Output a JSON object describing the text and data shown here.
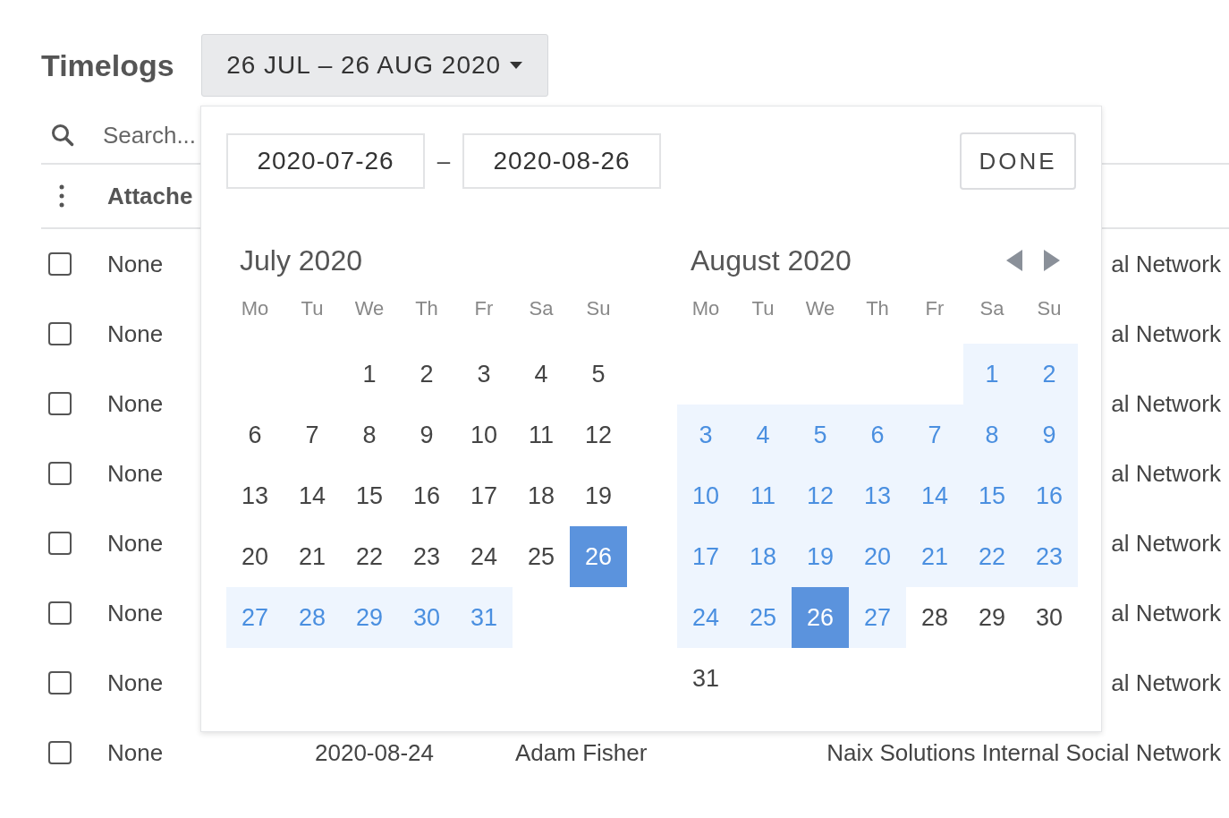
{
  "page": {
    "title": "Timelogs",
    "range_button": "26 JUL – 26 AUG 2020"
  },
  "search": {
    "placeholder": "Search..."
  },
  "table": {
    "columns": [
      {
        "label": "Attache"
      }
    ],
    "rows": [
      {
        "checked": false,
        "attached": "None",
        "project": "al Network"
      },
      {
        "checked": false,
        "attached": "None",
        "project": "al Network"
      },
      {
        "checked": false,
        "attached": "None",
        "project": "al Network"
      },
      {
        "checked": false,
        "attached": "None",
        "project": "al Network"
      },
      {
        "checked": false,
        "attached": "None",
        "project": "al Network"
      },
      {
        "checked": false,
        "attached": "None",
        "project": "al Network"
      },
      {
        "checked": false,
        "attached": "None",
        "project": "al Network"
      },
      {
        "checked": false,
        "attached": "None",
        "date": "2020-08-24",
        "user": "Adam Fisher",
        "project": "Naix Solutions Internal Social Network"
      }
    ]
  },
  "picker": {
    "start": "2020-07-26",
    "separator": "–",
    "end": "2020-08-26",
    "done": "DONE",
    "months": [
      {
        "title": "July 2020",
        "nav": false,
        "weekdays": [
          "Mo",
          "Tu",
          "We",
          "Th",
          "Fr",
          "Sa",
          "Su"
        ],
        "weeks": [
          [
            {
              "label": "1",
              "in_range": false,
              "selected": false
            },
            {
              "label": "2",
              "in_range": false,
              "selected": false
            },
            {
              "label": "3",
              "in_range": false,
              "selected": false
            },
            {
              "label": "4",
              "in_range": false,
              "selected": false
            },
            {
              "label": "5",
              "in_range": false,
              "selected": false
            }
          ],
          [
            {
              "label": "6",
              "in_range": false,
              "selected": false
            },
            {
              "label": "7",
              "in_range": false,
              "selected": false
            },
            {
              "label": "8",
              "in_range": false,
              "selected": false
            },
            {
              "label": "9",
              "in_range": false,
              "selected": false
            },
            {
              "label": "10",
              "in_range": false,
              "selected": false
            },
            {
              "label": "11",
              "in_range": false,
              "selected": false
            },
            {
              "label": "12",
              "in_range": false,
              "selected": false
            }
          ],
          [
            {
              "label": "13",
              "in_range": false,
              "selected": false
            },
            {
              "label": "14",
              "in_range": false,
              "selected": false
            },
            {
              "label": "15",
              "in_range": false,
              "selected": false
            },
            {
              "label": "16",
              "in_range": false,
              "selected": false
            },
            {
              "label": "17",
              "in_range": false,
              "selected": false
            },
            {
              "label": "18",
              "in_range": false,
              "selected": false
            },
            {
              "label": "19",
              "in_range": false,
              "selected": false
            }
          ],
          [
            {
              "label": "20",
              "in_range": false,
              "selected": false
            },
            {
              "label": "21",
              "in_range": false,
              "selected": false
            },
            {
              "label": "22",
              "in_range": false,
              "selected": false
            },
            {
              "label": "23",
              "in_range": false,
              "selected": false
            },
            {
              "label": "24",
              "in_range": false,
              "selected": false
            },
            {
              "label": "25",
              "in_range": false,
              "selected": false
            },
            {
              "label": "26",
              "selected": true
            }
          ],
          [
            {
              "label": "27",
              "in_range": true,
              "selected": false
            },
            {
              "label": "28",
              "in_range": true,
              "selected": false
            },
            {
              "label": "29",
              "in_range": true,
              "selected": false
            },
            {
              "label": "30",
              "in_range": true,
              "selected": false
            },
            {
              "label": "31",
              "in_range": true,
              "selected": false
            }
          ]
        ]
      },
      {
        "title": "August 2020",
        "nav": true,
        "weekdays": [
          "Mo",
          "Tu",
          "We",
          "Th",
          "Fr",
          "Sa",
          "Su"
        ],
        "weeks": [
          [
            {
              "label": "1",
              "in_range": true,
              "selected": false
            },
            {
              "label": "2",
              "in_range": true,
              "selected": false
            }
          ],
          [
            {
              "label": "3",
              "in_range": true,
              "selected": false
            },
            {
              "label": "4",
              "in_range": true,
              "selected": false
            },
            {
              "label": "5",
              "in_range": true,
              "selected": false
            },
            {
              "label": "6",
              "in_range": true,
              "selected": false
            },
            {
              "label": "7",
              "in_range": true,
              "selected": false
            },
            {
              "label": "8",
              "in_range": true,
              "selected": false
            },
            {
              "label": "9",
              "in_range": true,
              "selected": false
            }
          ],
          [
            {
              "label": "10",
              "in_range": true,
              "selected": false
            },
            {
              "label": "11",
              "in_range": true,
              "selected": false
            },
            {
              "label": "12",
              "in_range": true,
              "selected": false
            },
            {
              "label": "13",
              "in_range": true,
              "selected": false
            },
            {
              "label": "14",
              "in_range": true,
              "selected": false
            },
            {
              "label": "15",
              "in_range": true,
              "selected": false
            },
            {
              "label": "16",
              "in_range": true,
              "selected": false
            }
          ],
          [
            {
              "label": "17",
              "in_range": true,
              "selected": false
            },
            {
              "label": "18",
              "in_range": true,
              "selected": false
            },
            {
              "label": "19",
              "in_range": true,
              "selected": false
            },
            {
              "label": "20",
              "in_range": true,
              "selected": false
            },
            {
              "label": "21",
              "in_range": true,
              "selected": false
            },
            {
              "label": "22",
              "in_range": true,
              "selected": false
            },
            {
              "label": "23",
              "in_range": true,
              "selected": false
            }
          ],
          [
            {
              "label": "24",
              "in_range": true,
              "selected": false
            },
            {
              "label": "25",
              "in_range": true,
              "selected": false
            },
            {
              "label": "26",
              "selected": true
            },
            {
              "label": "27",
              "in_range": true,
              "selected": false
            },
            {
              "label": "28",
              "in_range": false,
              "selected": false
            },
            {
              "label": "29",
              "in_range": false,
              "selected": false
            },
            {
              "label": "30",
              "in_range": false,
              "selected": false
            }
          ],
          [
            {
              "label": "31",
              "in_range": false,
              "selected": false
            }
          ]
        ]
      }
    ]
  }
}
